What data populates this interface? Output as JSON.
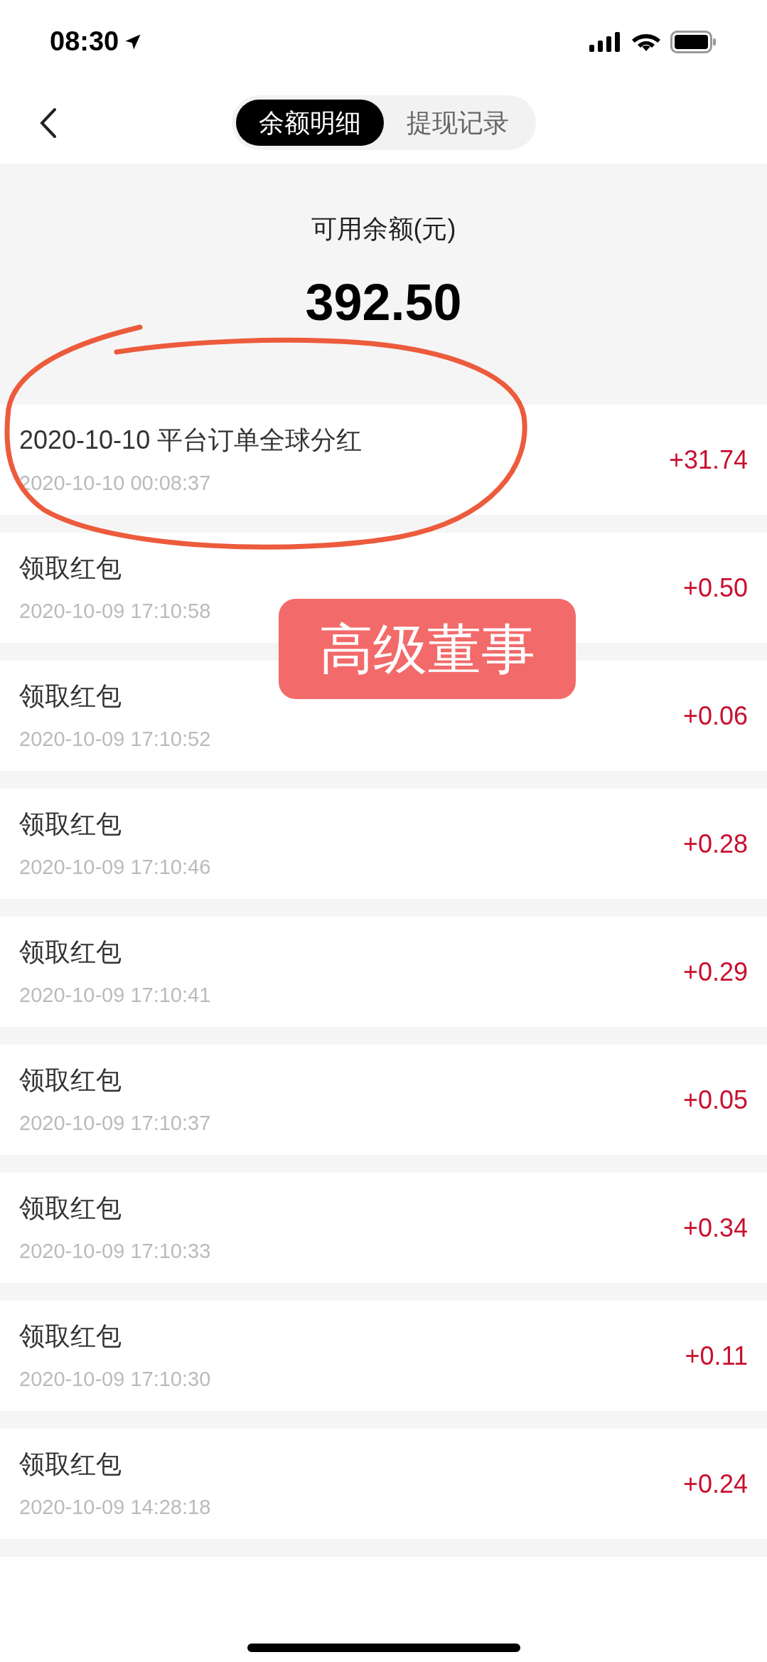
{
  "status_bar": {
    "time": "08:30"
  },
  "tabs": [
    {
      "label": "余额明细",
      "selected": true
    },
    {
      "label": "提现记录",
      "selected": false
    }
  ],
  "balance": {
    "label": "可用余额(元)",
    "amount": "392.50"
  },
  "transactions": [
    {
      "title": "2020-10-10 平台订单全球分红",
      "time": "2020-10-10 00:08:37",
      "amount": "+31.74"
    },
    {
      "title": "领取红包",
      "time": "2020-10-09 17:10:58",
      "amount": "+0.50"
    },
    {
      "title": "领取红包",
      "time": "2020-10-09 17:10:52",
      "amount": "+0.06"
    },
    {
      "title": "领取红包",
      "time": "2020-10-09 17:10:46",
      "amount": "+0.28"
    },
    {
      "title": "领取红包",
      "time": "2020-10-09 17:10:41",
      "amount": "+0.29"
    },
    {
      "title": "领取红包",
      "time": "2020-10-09 17:10:37",
      "amount": "+0.05"
    },
    {
      "title": "领取红包",
      "time": "2020-10-09 17:10:33",
      "amount": "+0.34"
    },
    {
      "title": "领取红包",
      "time": "2020-10-09 17:10:30",
      "amount": "+0.11"
    },
    {
      "title": "领取红包",
      "time": "2020-10-09 14:28:18",
      "amount": "+0.24"
    }
  ],
  "annotation": {
    "label": "高级董事"
  }
}
